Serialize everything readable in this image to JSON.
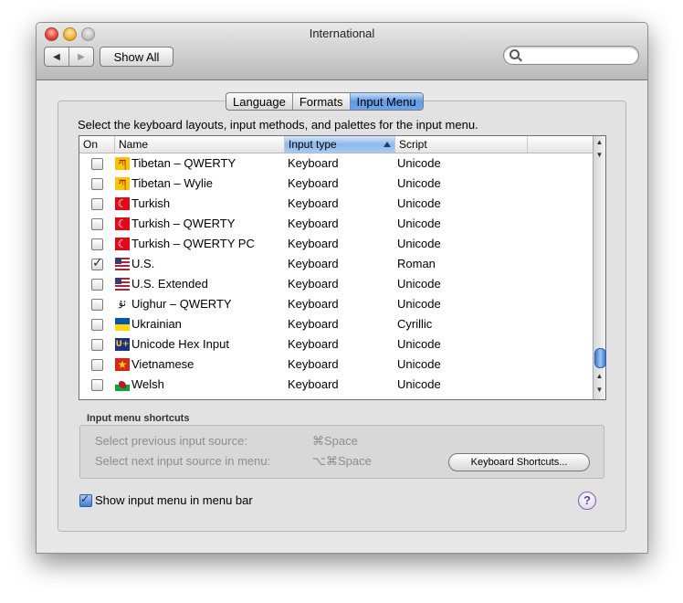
{
  "window": {
    "title": "International"
  },
  "toolbar": {
    "back_icon": "◀",
    "forward_icon": "▶",
    "show_all_label": "Show All",
    "search_value": "",
    "search_placeholder": ""
  },
  "tabs": [
    {
      "label": "Language",
      "active": false
    },
    {
      "label": "Formats",
      "active": false
    },
    {
      "label": "Input Menu",
      "active": true
    }
  ],
  "instructions": "Select the keyboard layouts, input methods, and palettes for the input menu.",
  "table": {
    "columns": [
      "On",
      "Name",
      "Input type",
      "Script"
    ],
    "sorted_column": "Input type",
    "rows": [
      {
        "on": false,
        "icon": "tibetan-icon",
        "glyph": "ཀ",
        "name": "Tibetan – QWERTY",
        "type": "Keyboard",
        "script": "Unicode"
      },
      {
        "on": false,
        "icon": "tibetan-icon",
        "glyph": "ཀ",
        "name": "Tibetan – Wylie",
        "type": "Keyboard",
        "script": "Unicode"
      },
      {
        "on": false,
        "icon": "turkey-flag-icon",
        "glyph": "☾",
        "name": "Turkish",
        "type": "Keyboard",
        "script": "Unicode"
      },
      {
        "on": false,
        "icon": "turkey-flag-icon",
        "glyph": "☾",
        "name": "Turkish – QWERTY",
        "type": "Keyboard",
        "script": "Unicode"
      },
      {
        "on": false,
        "icon": "turkey-flag-icon",
        "glyph": "☾",
        "name": "Turkish – QWERTY PC",
        "type": "Keyboard",
        "script": "Unicode"
      },
      {
        "on": true,
        "icon": "us-flag-icon",
        "glyph": "",
        "name": "U.S.",
        "type": "Keyboard",
        "script": "Roman"
      },
      {
        "on": false,
        "icon": "us-flag-icon",
        "glyph": "",
        "name": "U.S. Extended",
        "type": "Keyboard",
        "script": "Unicode"
      },
      {
        "on": false,
        "icon": "uighur-icon",
        "glyph": "ئۇ",
        "name": "Uighur – QWERTY",
        "type": "Keyboard",
        "script": "Unicode"
      },
      {
        "on": false,
        "icon": "ukraine-flag-icon",
        "glyph": "",
        "name": "Ukrainian",
        "type": "Keyboard",
        "script": "Cyrillic"
      },
      {
        "on": false,
        "icon": "unicode-hex-icon",
        "glyph": "U+",
        "name": "Unicode Hex Input",
        "type": "Keyboard",
        "script": "Unicode"
      },
      {
        "on": false,
        "icon": "vietnam-flag-icon",
        "glyph": "★",
        "name": "Vietnamese",
        "type": "Keyboard",
        "script": "Unicode"
      },
      {
        "on": false,
        "icon": "wales-flag-icon",
        "glyph": "",
        "name": "Welsh",
        "type": "Keyboard",
        "script": "Unicode"
      }
    ]
  },
  "shortcuts": {
    "label": "Input menu shortcuts",
    "prev_label": "Select previous input source:",
    "prev_key": "⌘Space",
    "next_label": "Select next input source in menu:",
    "next_key": "⌥⌘Space",
    "button_label": "Keyboard Shortcuts..."
  },
  "show_input_menu": {
    "label": "Show input menu in menu bar",
    "checked": true
  },
  "help": {
    "label": "?"
  }
}
